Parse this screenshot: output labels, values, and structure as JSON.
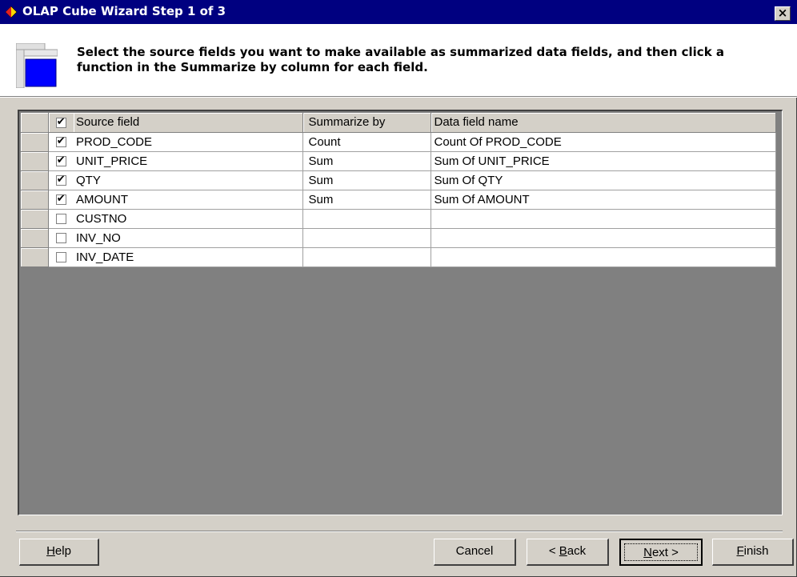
{
  "window": {
    "title": "OLAP Cube Wizard Step 1 of 3",
    "close_label": "×"
  },
  "instructions": "Select the source fields you want to make available as summarized data fields, and then click a function in the Summarize by column for each field.",
  "grid": {
    "columns": [
      "Source field",
      "Summarize by",
      "Data field name"
    ],
    "header_checked": true,
    "rows": [
      {
        "checked": true,
        "source": "PROD_CODE",
        "summarize": "Count",
        "name": "Count Of PROD_CODE"
      },
      {
        "checked": true,
        "source": "UNIT_PRICE",
        "summarize": "Sum",
        "name": "Sum Of UNIT_PRICE"
      },
      {
        "checked": true,
        "source": "QTY",
        "summarize": "Sum",
        "name": "Sum Of QTY"
      },
      {
        "checked": true,
        "source": "AMOUNT",
        "summarize": "Sum",
        "name": "Sum Of AMOUNT"
      },
      {
        "checked": false,
        "source": "CUSTNO",
        "summarize": "",
        "name": ""
      },
      {
        "checked": false,
        "source": "INV_NO",
        "summarize": "",
        "name": ""
      },
      {
        "checked": false,
        "source": "INV_DATE",
        "summarize": "",
        "name": ""
      }
    ]
  },
  "buttons": {
    "help": "Help",
    "cancel": "Cancel",
    "back": "< Back",
    "next": "Next >",
    "finish": "Finish"
  },
  "colors": {
    "titlebar": "#000080",
    "dialog": "#d4d0c8",
    "grid_empty": "#808080"
  },
  "icons": {
    "title": "olap-cube-icon",
    "wizard": "wizard-layout-icon"
  }
}
